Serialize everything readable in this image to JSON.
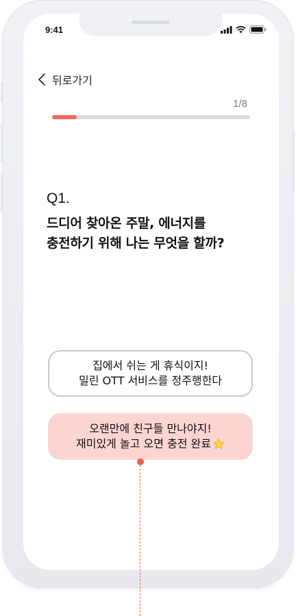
{
  "status_bar": {
    "time": "9:41",
    "icons": [
      "signal-icon",
      "wifi-icon",
      "battery-icon"
    ]
  },
  "nav": {
    "back_label": "뒤로가기"
  },
  "progress": {
    "label": "1/8",
    "fraction": 0.125,
    "fill_color": "#f06a5e",
    "track_color": "#dcdcdc"
  },
  "question": {
    "number": "Q1.",
    "line1": "드디어 찾아온 주말, 에너지를",
    "line2": "충전하기 위해 나는 무엇을 할까?"
  },
  "answers": [
    {
      "line1": "집에서 쉬는 게 휴식이지!",
      "line2": "밀린 OTT 서비스를 정주행한다",
      "selected": false
    },
    {
      "line1": "오랜만에 친구들 만나야지!",
      "line2": "재미있게 놀고 오면 충전 완료",
      "emoji": "star-icon",
      "selected": true
    }
  ],
  "colors": {
    "accent": "#ef5e52",
    "selected_bg": "#fcd5d2"
  }
}
